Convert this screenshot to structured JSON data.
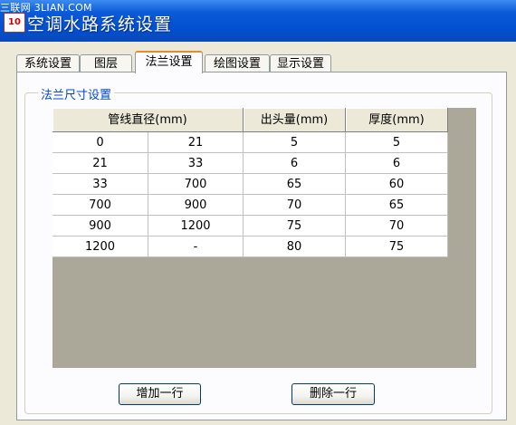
{
  "window": {
    "title": "空调水路系统设置",
    "watermark": "三联网 3LIAN.COM",
    "icon_text": "10"
  },
  "tabs": [
    {
      "label": "系统设置",
      "active": false
    },
    {
      "label": "图层",
      "active": false
    },
    {
      "label": "法兰设置",
      "active": true
    },
    {
      "label": "绘图设置",
      "active": false
    },
    {
      "label": "显示设置",
      "active": false
    }
  ],
  "group": {
    "label": "法兰尺寸设置"
  },
  "table": {
    "headers": [
      "管线直径(mm)",
      "出头量(mm)",
      "厚度(mm)"
    ],
    "rows": [
      [
        "0",
        "21",
        "5",
        "5"
      ],
      [
        "21",
        "33",
        "6",
        "6"
      ],
      [
        "33",
        "700",
        "65",
        "60"
      ],
      [
        "700",
        "900",
        "70",
        "65"
      ],
      [
        "900",
        "1200",
        "75",
        "70"
      ],
      [
        "1200",
        "-",
        "80",
        "75"
      ]
    ]
  },
  "buttons": {
    "add_row": "增加一行",
    "delete_row": "删除一行"
  },
  "colors": {
    "titlebar": "#0a5ad8",
    "group_label": "#0046d5",
    "grid_background": "#aca899",
    "active_tab_accent": "#e68b2c"
  }
}
